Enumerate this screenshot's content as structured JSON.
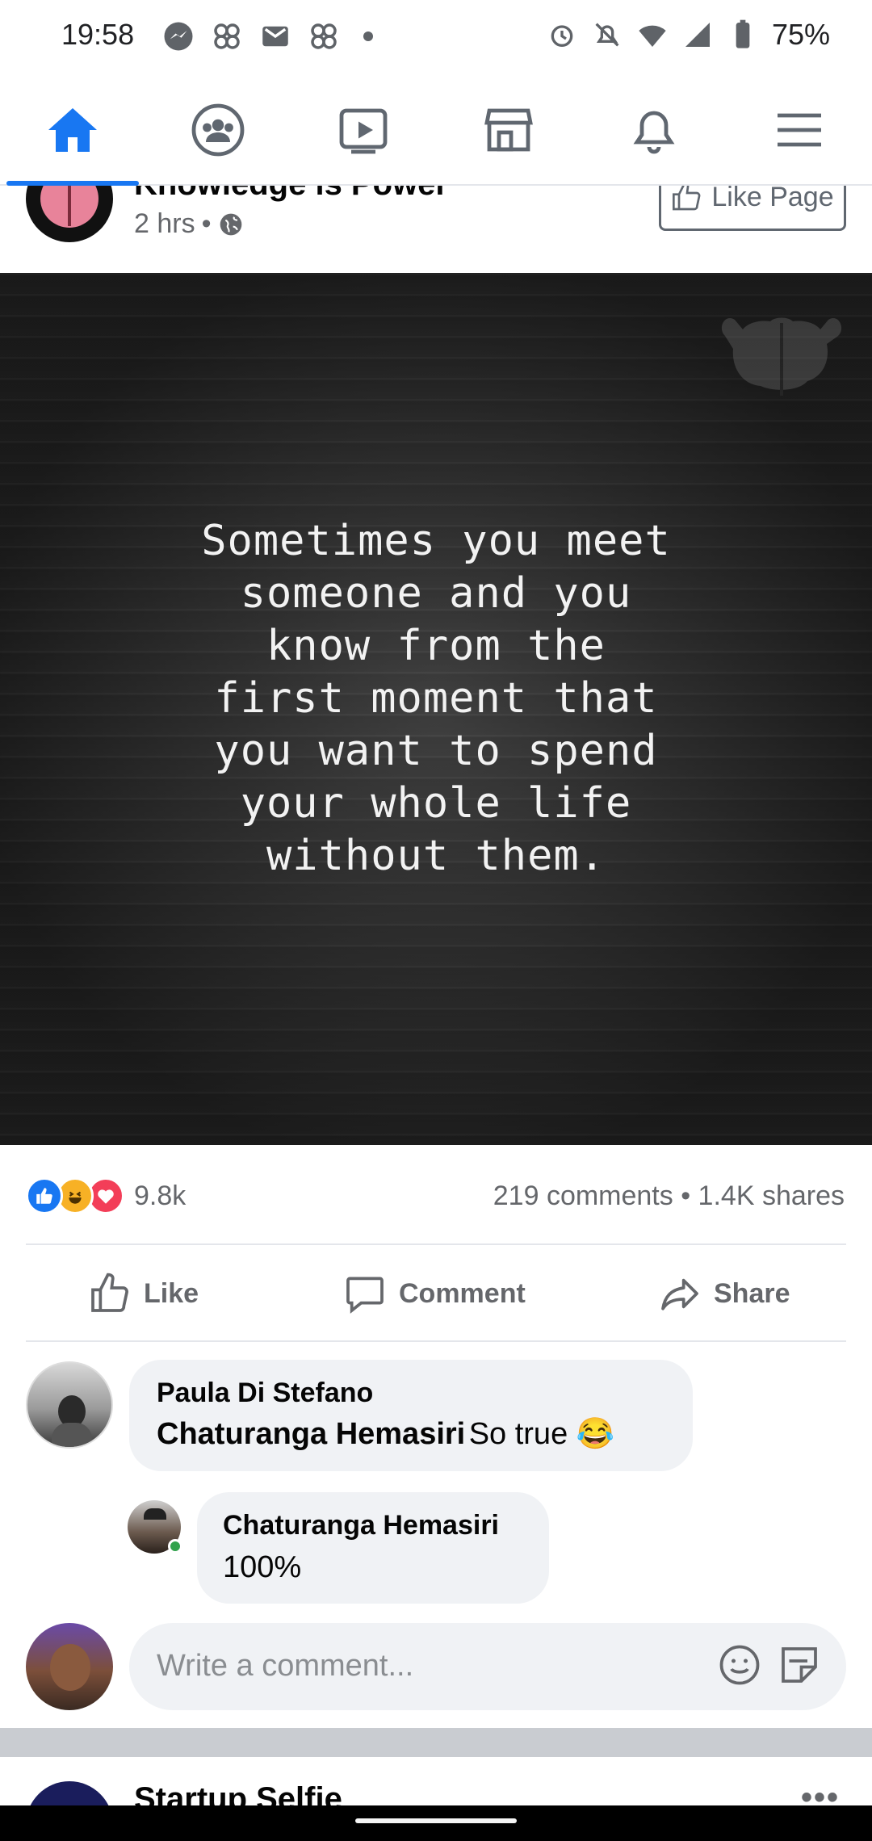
{
  "status_bar": {
    "time": "19:58",
    "battery": "75%",
    "left_icons": [
      "messenger-icon",
      "app-icon",
      "gmail-icon",
      "app-icon"
    ],
    "right_icons": [
      "alarm-icon",
      "bell-off-icon",
      "wifi-icon",
      "signal-icon",
      "battery-icon"
    ]
  },
  "nav": {
    "items": [
      {
        "name": "home",
        "active": true
      },
      {
        "name": "groups"
      },
      {
        "name": "watch"
      },
      {
        "name": "marketplace"
      },
      {
        "name": "notifications"
      },
      {
        "name": "menu"
      }
    ],
    "accent": "#1877f2"
  },
  "post": {
    "page_name": "Knowledge is Power",
    "time": "2 hrs",
    "separator": "•",
    "like_page_label": "Like Page",
    "quote_lines": [
      "Sometimes you meet",
      "someone and you",
      "know from the",
      "first moment that",
      "you want to spend",
      "your whole life",
      "without them."
    ],
    "reactions": [
      "like",
      "haha",
      "love"
    ],
    "reaction_count": "9.8k",
    "comments_shares": "219 comments • 1.4K shares",
    "actions": {
      "like": "Like",
      "comment": "Comment",
      "share": "Share"
    }
  },
  "comments": [
    {
      "author": "Paula Di Stefano",
      "tag": "Chaturanga Hemasiri",
      "text": "So true 😂"
    },
    {
      "author": "Chaturanga Hemasiri",
      "text": "100%",
      "reply": true
    }
  ],
  "composer": {
    "placeholder": "Write a comment..."
  },
  "next_post": {
    "page_name": "Startup Selfie",
    "more": "•••"
  }
}
